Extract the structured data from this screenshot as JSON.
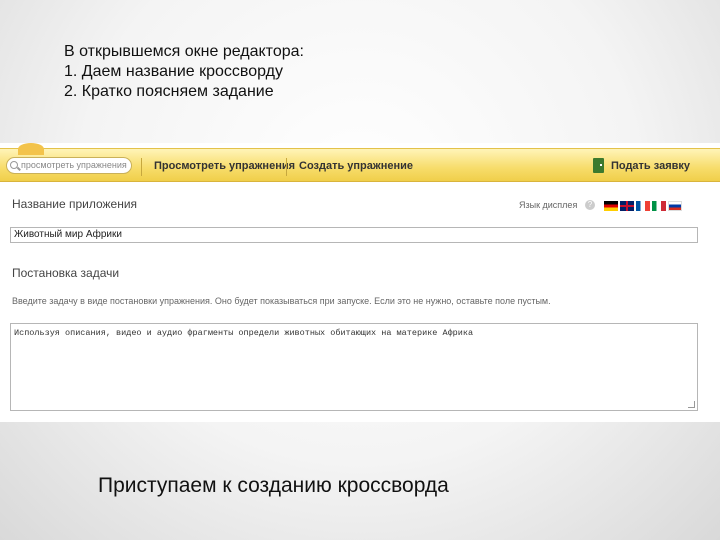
{
  "intro": {
    "line1": "В открывшемся окне редактора:",
    "line2": "1. Даем название кроссворду",
    "line3": "2. Кратко поясняем задание"
  },
  "toolbar": {
    "search_placeholder": "просмотреть упражнения",
    "view_exercises": "Просмотреть упражнения",
    "create_exercise": "Создать упражнение",
    "submit_request": "Подать заявку"
  },
  "form": {
    "app_name_label": "Название приложения",
    "language_label": "Язык дисплея",
    "help_symbol": "?",
    "app_name_value": "Животный мир Африки",
    "task_label": "Постановка задачи",
    "task_hint": "Введите задачу в виде постановки упражнения. Оно будет показываться при запуске. Если это не нужно, оставьте поле пустым.",
    "task_value": "Используя описания, видео и аудио фрагменты определи животных обитающих на материке Африка"
  },
  "flags": [
    {
      "name": "german-flag-icon",
      "colors": [
        "#000000",
        "#dd0000",
        "#ffce00"
      ]
    },
    {
      "name": "uk-flag-icon",
      "colors": [
        "#012169",
        "#ffffff",
        "#c8102e"
      ]
    },
    {
      "name": "french-flag-icon",
      "colors": [
        "#0055a4",
        "#ffffff",
        "#ef4135"
      ]
    },
    {
      "name": "italian-flag-icon",
      "colors": [
        "#009246",
        "#ffffff",
        "#ce2b37"
      ]
    },
    {
      "name": "russian-flag-icon",
      "colors": [
        "#ffffff",
        "#0039a6",
        "#d52b1e"
      ]
    }
  ],
  "footer": {
    "text": "Приступаем к созданию кроссворда"
  },
  "colors": {
    "toolbar_accent": "#f7dc6a"
  }
}
